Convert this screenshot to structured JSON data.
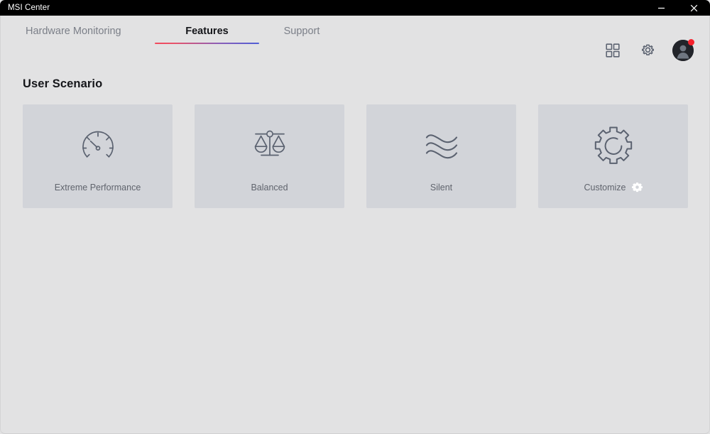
{
  "window": {
    "title": "MSI Center",
    "controls": [
      {
        "name": "minimize",
        "glyph": "minimize-icon"
      },
      {
        "name": "close",
        "glyph": "close-icon"
      }
    ]
  },
  "nav": {
    "tabs": [
      {
        "label": "Hardware Monitoring",
        "active": false
      },
      {
        "label": "Features",
        "active": true
      },
      {
        "label": "Support",
        "active": false
      }
    ],
    "active_tab_underline_colors": [
      "#f2495c",
      "#4f5ed6"
    ],
    "right_icons": [
      {
        "name": "apps-grid-icon",
        "label": "Apps"
      },
      {
        "name": "gear-icon",
        "label": "Settings"
      }
    ],
    "avatar": {
      "name": "user-avatar",
      "badge_color": "#f5222d",
      "has_notification": true
    }
  },
  "main": {
    "section_title": "User Scenario",
    "cards": [
      {
        "label": "Extreme Performance",
        "icon": "gauge-icon",
        "has_settings_gear": false
      },
      {
        "label": "Balanced",
        "icon": "balance-scale-icon",
        "has_settings_gear": false
      },
      {
        "label": "Silent",
        "icon": "waves-icon",
        "has_settings_gear": false
      },
      {
        "label": "Customize",
        "icon": "gear-outline-icon",
        "has_settings_gear": true
      }
    ]
  },
  "colors": {
    "titlebar_bg": "#000000",
    "app_bg": "#e2e2e3",
    "card_bg": "#d2d4d9",
    "icon_stroke": "#5b6270",
    "label_text": "#60646d",
    "active_tab_text": "#15161a",
    "inactive_tab_text": "#7b7f88"
  }
}
